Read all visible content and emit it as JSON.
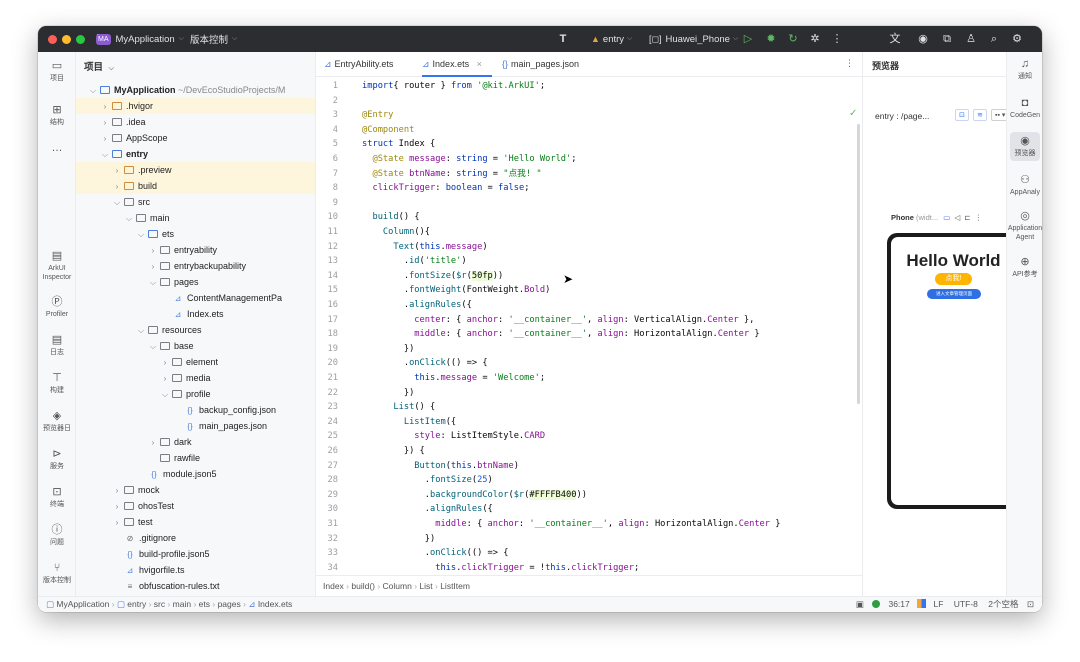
{
  "titlebar": {
    "project_badge": "MA",
    "project_name": "MyApplication",
    "vcs": "版本控制",
    "module": "entry",
    "device": "Huawei_Phone"
  },
  "left_toolbar": [
    {
      "label": "项目",
      "icon": "folder-icon"
    },
    {
      "label": "结构",
      "icon": "structure-icon"
    },
    {
      "label": "ArkUI Inspector",
      "icon": "inspector-icon"
    },
    {
      "label": "Profiler",
      "icon": "profiler-icon"
    },
    {
      "label": "日志",
      "icon": "log-icon"
    },
    {
      "label": "构建",
      "icon": "build-icon"
    },
    {
      "label": "预览器日",
      "icon": "previewer-log-icon"
    },
    {
      "label": "服务",
      "icon": "services-icon"
    },
    {
      "label": "终端",
      "icon": "terminal-icon"
    },
    {
      "label": "问题",
      "icon": "problems-icon"
    },
    {
      "label": "版本控制",
      "icon": "vcs-icon"
    }
  ],
  "project_panel": {
    "title": "项目",
    "tree": [
      {
        "label": "MyApplication",
        "suffix": " ~/DevEcoStudioProjects/M",
        "depth": 0,
        "arrow": "open",
        "icon": "module",
        "bold": true
      },
      {
        "label": ".hvigor",
        "depth": 1,
        "arrow": "closed",
        "icon": "folder-orange",
        "hl": true
      },
      {
        "label": ".idea",
        "depth": 1,
        "arrow": "closed",
        "icon": "folder"
      },
      {
        "label": "AppScope",
        "depth": 1,
        "arrow": "closed",
        "icon": "folder"
      },
      {
        "label": "entry",
        "depth": 1,
        "arrow": "open",
        "icon": "module",
        "bold": true
      },
      {
        "label": ".preview",
        "depth": 2,
        "arrow": "closed",
        "icon": "folder-orange",
        "hl": true
      },
      {
        "label": "build",
        "depth": 2,
        "arrow": "closed",
        "icon": "folder-orange",
        "hl": true
      },
      {
        "label": "src",
        "depth": 2,
        "arrow": "open",
        "icon": "folder"
      },
      {
        "label": "main",
        "depth": 3,
        "arrow": "open",
        "icon": "folder"
      },
      {
        "label": "ets",
        "depth": 4,
        "arrow": "open",
        "icon": "folder-blue"
      },
      {
        "label": "entryability",
        "depth": 5,
        "arrow": "closed",
        "icon": "folder"
      },
      {
        "label": "entrybackupability",
        "depth": 5,
        "arrow": "closed",
        "icon": "folder"
      },
      {
        "label": "pages",
        "depth": 5,
        "arrow": "open",
        "icon": "folder"
      },
      {
        "label": "ContentManagementPa",
        "depth": 6,
        "arrow": "",
        "icon": "ets"
      },
      {
        "label": "Index.ets",
        "depth": 6,
        "arrow": "",
        "icon": "ets"
      },
      {
        "label": "resources",
        "depth": 4,
        "arrow": "open",
        "icon": "folder"
      },
      {
        "label": "base",
        "depth": 5,
        "arrow": "open",
        "icon": "folder"
      },
      {
        "label": "element",
        "depth": 6,
        "arrow": "closed",
        "icon": "folder"
      },
      {
        "label": "media",
        "depth": 6,
        "arrow": "closed",
        "icon": "folder"
      },
      {
        "label": "profile",
        "depth": 6,
        "arrow": "open",
        "icon": "folder"
      },
      {
        "label": "backup_config.json",
        "depth": 7,
        "arrow": "",
        "icon": "json"
      },
      {
        "label": "main_pages.json",
        "depth": 7,
        "arrow": "",
        "icon": "json"
      },
      {
        "label": "dark",
        "depth": 5,
        "arrow": "closed",
        "icon": "folder"
      },
      {
        "label": "rawfile",
        "depth": 5,
        "arrow": "",
        "icon": "folder"
      },
      {
        "label": "module.json5",
        "depth": 4,
        "arrow": "",
        "icon": "json"
      },
      {
        "label": "mock",
        "depth": 2,
        "arrow": "closed",
        "icon": "folder"
      },
      {
        "label": "ohosTest",
        "depth": 2,
        "arrow": "closed",
        "icon": "folder"
      },
      {
        "label": "test",
        "depth": 2,
        "arrow": "closed",
        "icon": "folder"
      },
      {
        "label": ".gitignore",
        "depth": 2,
        "arrow": "",
        "icon": "ignore"
      },
      {
        "label": "build-profile.json5",
        "depth": 2,
        "arrow": "",
        "icon": "json"
      },
      {
        "label": "hvigorfile.ts",
        "depth": 2,
        "arrow": "",
        "icon": "ets"
      },
      {
        "label": "obfuscation-rules.txt",
        "depth": 2,
        "arrow": "",
        "icon": "txt"
      }
    ]
  },
  "editor": {
    "tabs": [
      {
        "label": "EntryAbility.ets",
        "icon": "ets",
        "active": false
      },
      {
        "label": "Index.ets",
        "icon": "ets",
        "active": true
      },
      {
        "label": "main_pages.json",
        "icon": "json",
        "active": false
      }
    ],
    "breadcrumb": [
      "Index",
      "build()",
      "Column",
      "List",
      "ListItem"
    ]
  },
  "code_lines": [
    {
      "n": "1",
      "p": [
        [
          "kw",
          "import"
        ],
        [
          "",
          "{ router } "
        ],
        [
          "kw",
          "from "
        ],
        [
          "str",
          "'@kit.ArkUI'"
        ],
        [
          "",
          ";"
        ]
      ]
    },
    {
      "n": "2",
      "p": []
    },
    {
      "n": "3",
      "p": [
        [
          "dec",
          "@Entry"
        ]
      ]
    },
    {
      "n": "4",
      "p": [
        [
          "dec",
          "@Component"
        ]
      ]
    },
    {
      "n": "5",
      "p": [
        [
          "kw",
          "struct "
        ],
        [
          "",
          "Index {"
        ]
      ]
    },
    {
      "n": "6",
      "p": [
        [
          "dec",
          "  @State "
        ],
        [
          "prop",
          "message"
        ],
        [
          "",
          ": "
        ],
        [
          "kw",
          "string"
        ],
        [
          "",
          " = "
        ],
        [
          "str",
          "'Hello World'"
        ],
        [
          "",
          ";"
        ]
      ]
    },
    {
      "n": "7",
      "p": [
        [
          "dec",
          "  @State "
        ],
        [
          "prop",
          "btnName"
        ],
        [
          "",
          ": "
        ],
        [
          "kw",
          "string"
        ],
        [
          "",
          " = "
        ],
        [
          "str",
          "\"点我! \""
        ]
      ]
    },
    {
      "n": "8",
      "p": [
        [
          "prop",
          "  clickTrigger"
        ],
        [
          "",
          ": "
        ],
        [
          "kw",
          "boolean"
        ],
        [
          "",
          " = "
        ],
        [
          "kw",
          "false"
        ],
        [
          "",
          ";"
        ]
      ]
    },
    {
      "n": "9",
      "p": []
    },
    {
      "n": "10",
      "p": [
        [
          "fn",
          "  build"
        ],
        [
          "",
          "() {"
        ]
      ]
    },
    {
      "n": "11",
      "p": [
        [
          "fn",
          "    Column"
        ],
        [
          "",
          "(){"
        ]
      ]
    },
    {
      "n": "12",
      "p": [
        [
          "fn",
          "      Text"
        ],
        [
          "",
          "("
        ],
        [
          "kw",
          "this"
        ],
        [
          "",
          "."
        ],
        [
          "prop",
          "message"
        ],
        [
          "",
          ")"
        ]
      ]
    },
    {
      "n": "13",
      "p": [
        [
          "",
          "        ."
        ],
        [
          "fn",
          "id"
        ],
        [
          "",
          "("
        ],
        [
          "str",
          "'title'"
        ],
        [
          "",
          ")"
        ]
      ]
    },
    {
      "n": "14",
      "p": [
        [
          "",
          "        ."
        ],
        [
          "fn",
          "fontSize"
        ],
        [
          "",
          "("
        ],
        [
          "fn",
          "$r"
        ],
        [
          "",
          "("
        ],
        [
          "hl",
          "50fp"
        ],
        [
          "",
          "))"
        ]
      ]
    },
    {
      "n": "15",
      "p": [
        [
          "",
          "        ."
        ],
        [
          "fn",
          "fontWeight"
        ],
        [
          "",
          "(FontWeight."
        ],
        [
          "prop",
          "Bold"
        ],
        [
          "",
          ")"
        ]
      ]
    },
    {
      "n": "16",
      "p": [
        [
          "",
          "        ."
        ],
        [
          "fn",
          "alignRules"
        ],
        [
          "",
          "({"
        ]
      ]
    },
    {
      "n": "17",
      "p": [
        [
          "prop",
          "          center"
        ],
        [
          "",
          ": { "
        ],
        [
          "prop",
          "anchor"
        ],
        [
          "",
          ": "
        ],
        [
          "str",
          "'__container__'"
        ],
        [
          "",
          ", "
        ],
        [
          "prop",
          "align"
        ],
        [
          "",
          ": VerticalAlign."
        ],
        [
          "prop",
          "Center"
        ],
        [
          "",
          " },"
        ]
      ]
    },
    {
      "n": "18",
      "p": [
        [
          "prop",
          "          middle"
        ],
        [
          "",
          ": { "
        ],
        [
          "prop",
          "anchor"
        ],
        [
          "",
          ": "
        ],
        [
          "str",
          "'__container__'"
        ],
        [
          "",
          ", "
        ],
        [
          "prop",
          "align"
        ],
        [
          "",
          ": HorizontalAlign."
        ],
        [
          "prop",
          "Center"
        ],
        [
          "",
          " }"
        ]
      ]
    },
    {
      "n": "19",
      "p": [
        [
          "",
          "        })"
        ]
      ]
    },
    {
      "n": "20",
      "p": [
        [
          "",
          "        ."
        ],
        [
          "fn",
          "onClick"
        ],
        [
          "",
          "(() => {"
        ]
      ]
    },
    {
      "n": "21",
      "p": [
        [
          "kw",
          "          this"
        ],
        [
          "",
          "."
        ],
        [
          "prop",
          "message"
        ],
        [
          "",
          " = "
        ],
        [
          "str",
          "'Welcome'"
        ],
        [
          "",
          ";"
        ]
      ]
    },
    {
      "n": "22",
      "p": [
        [
          "",
          "        })"
        ]
      ]
    },
    {
      "n": "23",
      "p": [
        [
          "fn",
          "      List"
        ],
        [
          "",
          "() {"
        ]
      ]
    },
    {
      "n": "24",
      "p": [
        [
          "fn",
          "        ListItem"
        ],
        [
          "",
          "({"
        ]
      ]
    },
    {
      "n": "25",
      "p": [
        [
          "prop",
          "          style"
        ],
        [
          "",
          ": ListItemStyle."
        ],
        [
          "prop",
          "CARD"
        ]
      ]
    },
    {
      "n": "26",
      "p": [
        [
          "",
          "        }) {"
        ]
      ]
    },
    {
      "n": "27",
      "p": [
        [
          "fn",
          "          Button"
        ],
        [
          "",
          "("
        ],
        [
          "kw",
          "this"
        ],
        [
          "",
          "."
        ],
        [
          "prop",
          "btnName"
        ],
        [
          "",
          ")"
        ]
      ]
    },
    {
      "n": "28",
      "p": [
        [
          "",
          "            ."
        ],
        [
          "fn",
          "fontSize"
        ],
        [
          "",
          "("
        ],
        [
          "num",
          "25"
        ],
        [
          "",
          ")"
        ]
      ]
    },
    {
      "n": "29",
      "p": [
        [
          "",
          "            ."
        ],
        [
          "fn",
          "backgroundColor"
        ],
        [
          "",
          "("
        ],
        [
          "fn",
          "$r"
        ],
        [
          "",
          "("
        ],
        [
          "hl",
          "#FFFFB400"
        ],
        [
          "",
          "))"
        ]
      ]
    },
    {
      "n": "30",
      "p": [
        [
          "",
          "            ."
        ],
        [
          "fn",
          "alignRules"
        ],
        [
          "",
          "({"
        ]
      ]
    },
    {
      "n": "31",
      "p": [
        [
          "prop",
          "              middle"
        ],
        [
          "",
          ": { "
        ],
        [
          "prop",
          "anchor"
        ],
        [
          "",
          ": "
        ],
        [
          "str",
          "'__container__'"
        ],
        [
          "",
          ", "
        ],
        [
          "prop",
          "align"
        ],
        [
          "",
          ": HorizontalAlign."
        ],
        [
          "prop",
          "Center"
        ],
        [
          "",
          " }"
        ]
      ]
    },
    {
      "n": "32",
      "p": [
        [
          "",
          "            })"
        ]
      ]
    },
    {
      "n": "33",
      "p": [
        [
          "",
          "            ."
        ],
        [
          "fn",
          "onClick"
        ],
        [
          "",
          "(() => {"
        ]
      ]
    },
    {
      "n": "34",
      "p": [
        [
          "kw",
          "              this"
        ],
        [
          "",
          "."
        ],
        [
          "prop",
          "clickTrigger"
        ],
        [
          "",
          " = !"
        ],
        [
          "kw",
          "this"
        ],
        [
          "",
          "."
        ],
        [
          "prop",
          "clickTrigger"
        ],
        [
          "",
          ";"
        ]
      ]
    }
  ],
  "previewer": {
    "title": "预览器",
    "page_select": "entry : /page...",
    "device_label": "Phone",
    "device_suffix": " (widt...",
    "screen_title": "Hello World",
    "screen_button": "点我!",
    "screen_link": "进入文章管理页面"
  },
  "right_toolbar": [
    {
      "label": "通知",
      "icon": "bell-icon"
    },
    {
      "label": "CodeGen",
      "icon": "codegen-icon"
    },
    {
      "label": "预览器",
      "icon": "eye-icon"
    },
    {
      "label": "AppAnaly",
      "icon": "analyzer-icon"
    },
    {
      "label": "Application Agent",
      "icon": "agent-icon"
    },
    {
      "label": "API参考",
      "icon": "api-icon"
    }
  ],
  "statusbar": {
    "path": [
      "MyApplication",
      "entry",
      "src",
      "main",
      "ets",
      "pages",
      "Index.ets"
    ],
    "position": "36:17",
    "line_sep": "LF",
    "encoding": "UTF-8",
    "indent": "2个空格"
  },
  "colors": {
    "accent": "#3574f0",
    "title_bg": "#2b2d30",
    "phone_button": "#ffb400",
    "phone_link": "#2f6fe4"
  }
}
